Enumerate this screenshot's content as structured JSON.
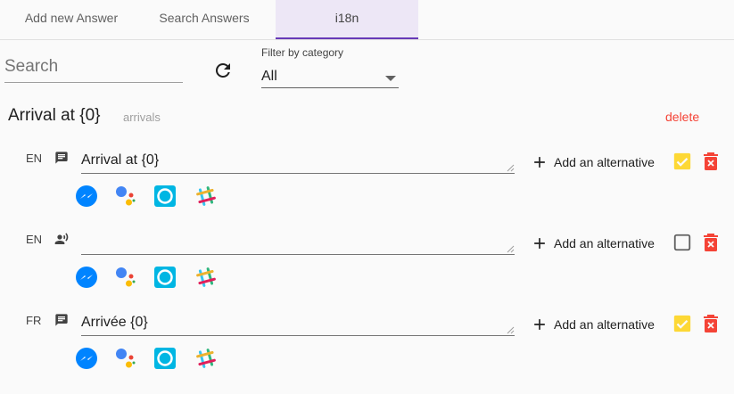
{
  "tabs": [
    {
      "label": "Add new Answer",
      "active": false
    },
    {
      "label": "Search Answers",
      "active": false
    },
    {
      "label": "i18n",
      "active": true
    }
  ],
  "toolbar": {
    "search_placeholder": "Search",
    "filter_label": "Filter by category",
    "filter_value": "All"
  },
  "card": {
    "title": "Arrival at {0}",
    "category": "arrivals",
    "delete_label": "delete"
  },
  "entries": [
    {
      "lang": "EN",
      "type_icon": "chat-icon",
      "text": "Arrival at {0}",
      "add_alt_label": "Add an alternative",
      "checked": true
    },
    {
      "lang": "EN",
      "type_icon": "voice-icon",
      "text": "",
      "add_alt_label": "Add an alternative",
      "checked": false
    },
    {
      "lang": "FR",
      "type_icon": "chat-icon",
      "text": "Arrivée {0}",
      "add_alt_label": "Add an alternative",
      "checked": true
    }
  ],
  "channel_icons": [
    "messenger-icon",
    "google-assistant-icon",
    "alexa-icon",
    "slack-icon"
  ],
  "colors": {
    "accent": "#673ab7",
    "active_tab_bg": "#ede7f6",
    "delete_red": "#f44336",
    "checked_yellow": "#fdd835",
    "messenger_blue": "#0084ff",
    "alexa_cyan": "#00b6e3"
  }
}
